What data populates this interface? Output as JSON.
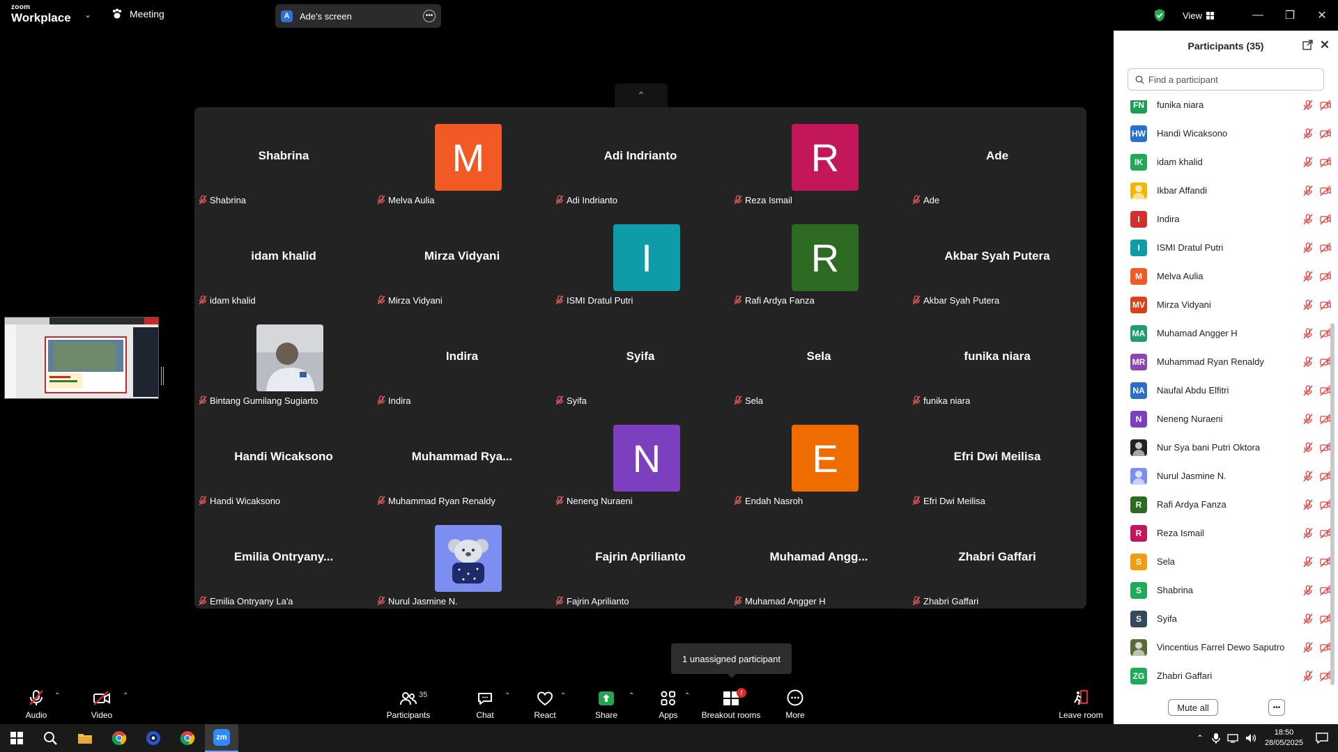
{
  "titlebar": {
    "logo_small": "zoom",
    "logo_big": "Workplace",
    "meeting_label": "Meeting",
    "screen_share_avatar": "A",
    "screen_share_label": "Ade's screen",
    "view_label": "View",
    "secure_color": "#23a84c"
  },
  "tiles": [
    {
      "bigname": "Shabrina",
      "label": "Shabrina"
    },
    {
      "avatar": "M",
      "color": "#f15a24",
      "label": "Melva Aulia"
    },
    {
      "bigname": "Adi Indrianto",
      "label": "Adi Indrianto"
    },
    {
      "avatar": "R",
      "color": "#c2185b",
      "label": "Reza Ismail"
    },
    {
      "bigname": "Ade",
      "label": "Ade"
    },
    {
      "bigname": "idam khalid",
      "label": "idam khalid"
    },
    {
      "bigname": "Mirza Vidyani",
      "label": "Mirza Vidyani"
    },
    {
      "avatar": "I",
      "color": "#0e9ca8",
      "label": "ISMI Dratul Putri"
    },
    {
      "avatar": "R",
      "color": "#2e6b22",
      "label": "Rafi Ardya Fanza"
    },
    {
      "bigname": "Akbar Syah Putera",
      "label": "Akbar Syah Putera"
    },
    {
      "photo": "person-photo",
      "label": "Bintang Gumilang Sugiarto"
    },
    {
      "bigname": "Indira",
      "label": "Indira"
    },
    {
      "bigname": "Syifa",
      "label": "Syifa"
    },
    {
      "bigname": "Sela",
      "label": "Sela"
    },
    {
      "bigname": "funika niara",
      "label": "funika niara"
    },
    {
      "bigname": "Handi Wicaksono",
      "label": "Handi Wicaksono"
    },
    {
      "bigname": "Muhammad  Rya...",
      "label": "Muhammad Ryan Renaldy"
    },
    {
      "avatar": "N",
      "color": "#7b3fbf",
      "label": "Neneng Nuraeni"
    },
    {
      "avatar": "E",
      "color": "#ef6c00",
      "label": "Endah Nasroh"
    },
    {
      "bigname": "Efri Dwi Meilisa",
      "label": "Efri Dwi Meilisa"
    },
    {
      "bigname": "Emilia  Ontryany...",
      "label": "Emilia Ontryany La'a"
    },
    {
      "photo": "koala-avatar",
      "label": "Nurul Jasmine N."
    },
    {
      "bigname": "Fajrin Aprilianto",
      "label": "Fajrin Aprilianto"
    },
    {
      "bigname": "Muhamad  Angg...",
      "label": "Muhamad Angger H"
    },
    {
      "bigname": "Zhabri Gaffari",
      "label": "Zhabri Gaffari"
    }
  ],
  "tooltip": "1 unassigned participant",
  "toolbar": {
    "audio": "Audio",
    "video": "Video",
    "participants": "Participants",
    "participants_count": "35",
    "chat": "Chat",
    "react": "React",
    "share": "Share",
    "apps": "Apps",
    "breakout": "Breakout rooms",
    "breakout_badge": "!",
    "more": "More",
    "leave": "Leave room"
  },
  "panel": {
    "title": "Participants (35)",
    "search_placeholder": "Find a participant",
    "mute_all": "Mute all",
    "participants": [
      {
        "initials": "FN",
        "color": "#1f9d55",
        "name": "funika niara"
      },
      {
        "initials": "HW",
        "color": "#2a6fc9",
        "name": "Handi Wicaksono"
      },
      {
        "initials": "IK",
        "color": "#1faa59",
        "name": "idam khalid"
      },
      {
        "initials": "",
        "color": "#f2b705",
        "name": "Ikbar Affandi",
        "photo": true
      },
      {
        "initials": "I",
        "color": "#d32f2f",
        "name": "Indira"
      },
      {
        "initials": "I",
        "color": "#0e9ca8",
        "name": "ISMI Dratul Putri"
      },
      {
        "initials": "M",
        "color": "#f15a24",
        "name": "Melva Aulia"
      },
      {
        "initials": "MV",
        "color": "#d84315",
        "name": "Mirza Vidyani"
      },
      {
        "initials": "MA",
        "color": "#1f9d70",
        "name": "Muhamad Angger H"
      },
      {
        "initials": "MR",
        "color": "#8e44ad",
        "name": "Muhammad Ryan Renaldy"
      },
      {
        "initials": "NA",
        "color": "#2a6fc9",
        "name": "Naufal Abdu Elfitri"
      },
      {
        "initials": "N",
        "color": "#7b3fbf",
        "name": "Neneng Nuraeni"
      },
      {
        "initials": "",
        "color": "#222222",
        "name": "Nur Sya bani Putri Oktora",
        "photo": true
      },
      {
        "initials": "",
        "color": "#7c8ff0",
        "name": "Nurul Jasmine N.",
        "photo": true
      },
      {
        "initials": "R",
        "color": "#2e6b22",
        "name": "Rafi Ardya Fanza"
      },
      {
        "initials": "R",
        "color": "#c2185b",
        "name": "Reza Ismail"
      },
      {
        "initials": "S",
        "color": "#f39c12",
        "name": "Sela"
      },
      {
        "initials": "S",
        "color": "#1faa59",
        "name": "Shabrina"
      },
      {
        "initials": "S",
        "color": "#34495e",
        "name": "Syifa"
      },
      {
        "initials": "",
        "color": "#5a6b3a",
        "name": "Vincentius Farrel Dewo Saputro",
        "photo": true
      },
      {
        "initials": "ZG",
        "color": "#1faa59",
        "name": "Zhabri Gaffari"
      }
    ]
  },
  "taskbar": {
    "time": "18:50",
    "date": "28/05/2025",
    "zoom_icon_label": "zm"
  }
}
